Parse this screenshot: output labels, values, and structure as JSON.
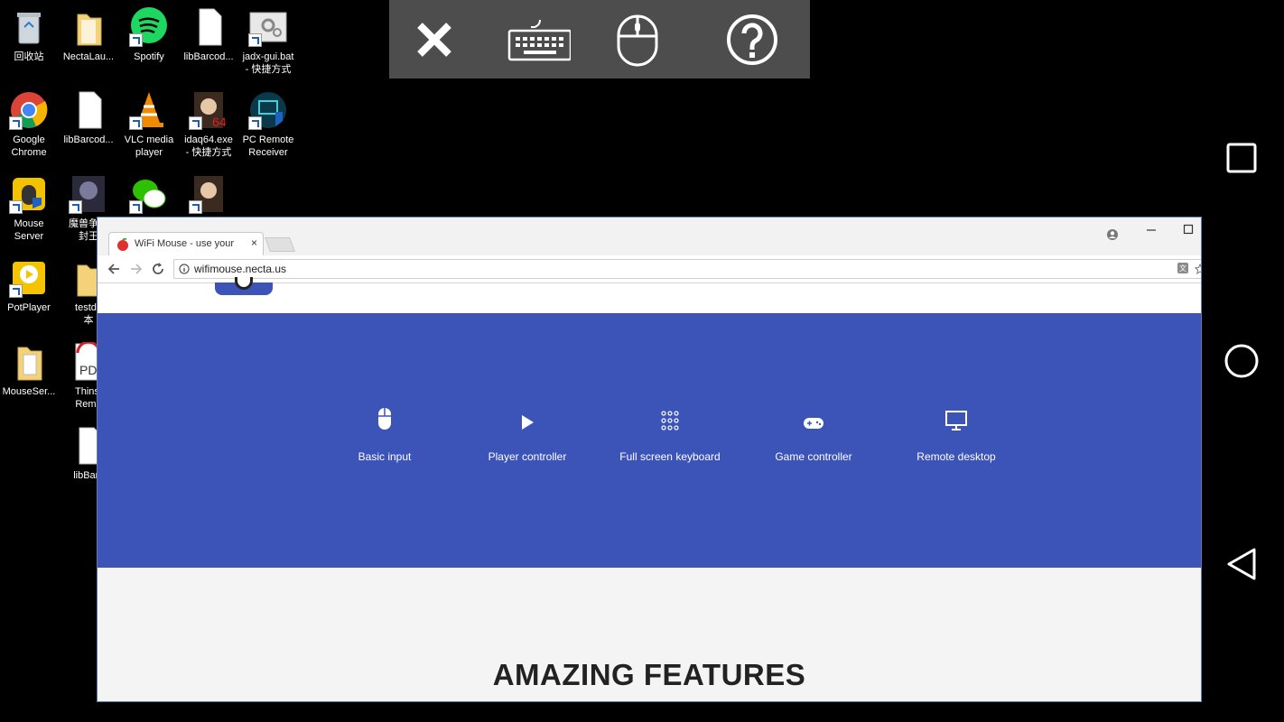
{
  "desktop": {
    "icons": [
      {
        "label": "回收站"
      },
      {
        "label": "NectaLau..."
      },
      {
        "label": "Spotify"
      },
      {
        "label": "libBarcod..."
      },
      {
        "label": "jadx-gui.bat\n- 快捷方式"
      },
      {
        "label": "Google\nChrome"
      },
      {
        "label": "libBarcod..."
      },
      {
        "label": "VLC media\nplayer"
      },
      {
        "label": "idaq64.exe\n- 快捷方式"
      },
      {
        "label": "PC Remote\nReceiver"
      },
      {
        "label": "Mouse\nServer"
      },
      {
        "label": "魔兽争霸\n封王"
      },
      {
        "label": "PotPlayer"
      },
      {
        "label": "testde\n本"
      },
      {
        "label": "MouseSer..."
      },
      {
        "label": "Thinst\nRemo"
      },
      {
        "label": "libBarc"
      }
    ]
  },
  "toolbar": {
    "buttons": [
      {
        "icon": "close-icon"
      },
      {
        "icon": "keyboard-icon"
      },
      {
        "icon": "mouse-icon"
      },
      {
        "icon": "help-icon"
      }
    ]
  },
  "browser": {
    "tab_title": "WiFi Mouse - use your",
    "tab_close": "×",
    "url": "wifimouse.necta.us",
    "hero_features": [
      {
        "label": "Basic input",
        "icon": "mouse-icon"
      },
      {
        "label": "Player controller",
        "icon": "play-icon"
      },
      {
        "label": "Full screen keyboard",
        "icon": "keypad-icon"
      },
      {
        "label": "Game controller",
        "icon": "gamepad-icon"
      },
      {
        "label": "Remote desktop",
        "icon": "monitor-icon"
      }
    ],
    "section_heading": "AMAZING FEATURES",
    "hero_color": "#3c53b7"
  },
  "android_nav": {
    "buttons": [
      {
        "icon": "recents-icon"
      },
      {
        "icon": "home-icon"
      },
      {
        "icon": "back-icon"
      }
    ]
  }
}
